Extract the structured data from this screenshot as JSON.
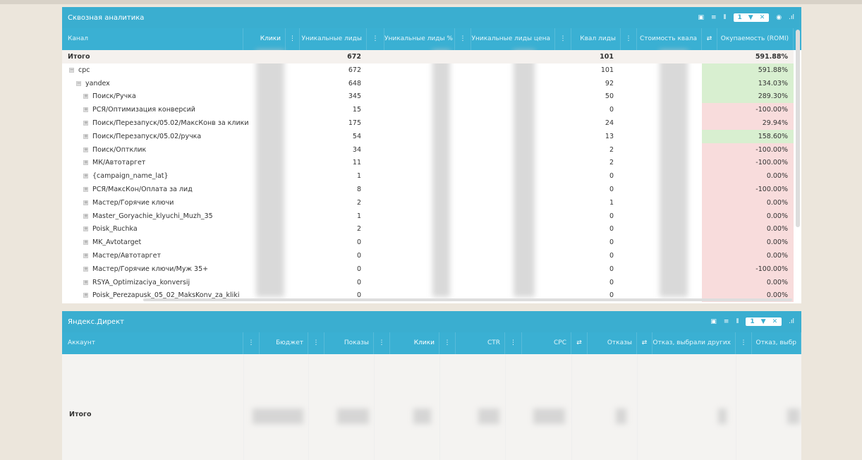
{
  "panel1": {
    "title": "Сквозная аналитика",
    "filter_count": "1",
    "columns": [
      "Канал",
      "Клики",
      "Уникальные лиды",
      "Уникальные лиды %",
      "Уникальные лиды цена",
      "Квал лиды",
      "Стоимость квала",
      "Окупаемость (ROMI)"
    ],
    "rows": [
      {
        "name": "Итого",
        "level": 0,
        "bold": true,
        "leads": "672",
        "qual": "101",
        "romi": "591.88%",
        "romi_status": "total"
      },
      {
        "name": "cpc",
        "level": 1,
        "toggle": "−",
        "leads": "672",
        "qual": "101",
        "romi": "591.88%",
        "romi_status": "positive"
      },
      {
        "name": "yandex",
        "level": 2,
        "toggle": "−",
        "leads": "648",
        "qual": "92",
        "romi": "134.03%",
        "romi_status": "positive"
      },
      {
        "name": "Поиск/Ручка",
        "level": 3,
        "toggle": "+",
        "leads": "345",
        "qual": "50",
        "romi": "289.30%",
        "romi_status": "positive"
      },
      {
        "name": "РСЯ/Оптимизация конверсий",
        "level": 3,
        "toggle": "+",
        "leads": "15",
        "qual": "0",
        "romi": "-100.00%",
        "romi_status": "negative"
      },
      {
        "name": "Поиск/Перезапуск/05.02/МаксКонв за клики",
        "level": 3,
        "toggle": "+",
        "leads": "175",
        "qual": "24",
        "romi": "29.94%",
        "romi_status": "negative"
      },
      {
        "name": "Поиск/Перезапуск/05.02/ручка",
        "level": 3,
        "toggle": "+",
        "leads": "54",
        "qual": "13",
        "romi": "158.60%",
        "romi_status": "positive"
      },
      {
        "name": "Поиск/Оптклик",
        "level": 3,
        "toggle": "+",
        "leads": "34",
        "qual": "2",
        "romi": "-100.00%",
        "romi_status": "negative"
      },
      {
        "name": "МК/Автотаргет",
        "level": 3,
        "toggle": "+",
        "leads": "11",
        "qual": "2",
        "romi": "-100.00%",
        "romi_status": "negative"
      },
      {
        "name": "{campaign_name_lat}",
        "level": 3,
        "toggle": "+",
        "leads": "1",
        "qual": "0",
        "romi": "0.00%",
        "romi_status": "negative"
      },
      {
        "name": "РСЯ/МаксКон/Оплата за лид",
        "level": 3,
        "toggle": "+",
        "leads": "8",
        "qual": "0",
        "romi": "-100.00%",
        "romi_status": "negative"
      },
      {
        "name": "Мастер/Горячие ключи",
        "level": 3,
        "toggle": "+",
        "leads": "2",
        "qual": "1",
        "romi": "0.00%",
        "romi_status": "negative"
      },
      {
        "name": "Master_Goryachie_klyuchi_Muzh_35",
        "level": 3,
        "toggle": "+",
        "leads": "1",
        "qual": "0",
        "romi": "0.00%",
        "romi_status": "negative"
      },
      {
        "name": "Poisk_Ruchka",
        "level": 3,
        "toggle": "+",
        "leads": "2",
        "qual": "0",
        "romi": "0.00%",
        "romi_status": "negative"
      },
      {
        "name": "MK_Avtotarget",
        "level": 3,
        "toggle": "+",
        "leads": "0",
        "qual": "0",
        "romi": "0.00%",
        "romi_status": "negative"
      },
      {
        "name": "Мастер/Автотаргет",
        "level": 3,
        "toggle": "+",
        "leads": "0",
        "qual": "0",
        "romi": "0.00%",
        "romi_status": "negative"
      },
      {
        "name": "Мастер/Горячие ключи/Муж 35+",
        "level": 3,
        "toggle": "+",
        "leads": "0",
        "qual": "0",
        "romi": "-100.00%",
        "romi_status": "negative"
      },
      {
        "name": "RSYA_Optimizaciya_konversij",
        "level": 3,
        "toggle": "+",
        "leads": "0",
        "qual": "0",
        "romi": "0.00%",
        "romi_status": "negative"
      },
      {
        "name": "Poisk_Perezapusk_05_02_MaksKonv_za_kliki",
        "level": 3,
        "toggle": "+",
        "leads": "0",
        "qual": "0",
        "romi": "0.00%",
        "romi_status": "negative"
      }
    ]
  },
  "panel2": {
    "title": "Яндекс.Директ",
    "filter_count": "1",
    "columns": [
      "Аккаунт",
      "Бюджет",
      "Показы",
      "Клики",
      "CTR",
      "CPC",
      "Отказы",
      "Отказ, выбрали других",
      "Отказ, выбр"
    ],
    "total_label": "Итого"
  },
  "colors": {
    "header": "#3aaed0",
    "positive": "#d8efd0",
    "negative": "#f8dcdc",
    "total": "#f5f1ee"
  }
}
